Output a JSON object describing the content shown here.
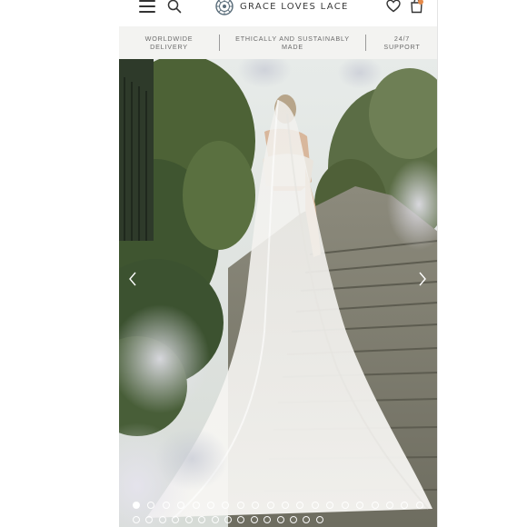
{
  "header": {
    "brand": "GRACE LOVES LACE",
    "icons": [
      "menu-icon",
      "search-icon",
      "heart-icon",
      "bag-icon"
    ],
    "cart_indicator_color": "#e48a4a"
  },
  "value_strip": {
    "items": [
      {
        "line1": "WORLDWIDE",
        "line2": "DELIVERY"
      },
      {
        "line1": "ETHICALLY AND SUSTAINABLY",
        "line2": "MADE"
      },
      {
        "line1": "24/7",
        "line2": "SUPPORT"
      }
    ]
  },
  "carousel": {
    "active_index": 0,
    "row1_dots": 20,
    "row2_dots": 15,
    "controls": [
      "chevron-left-icon",
      "chevron-right-icon"
    ]
  },
  "colors": {
    "text": "#3a3a3a",
    "strip_bg": "#f3f3f1"
  }
}
